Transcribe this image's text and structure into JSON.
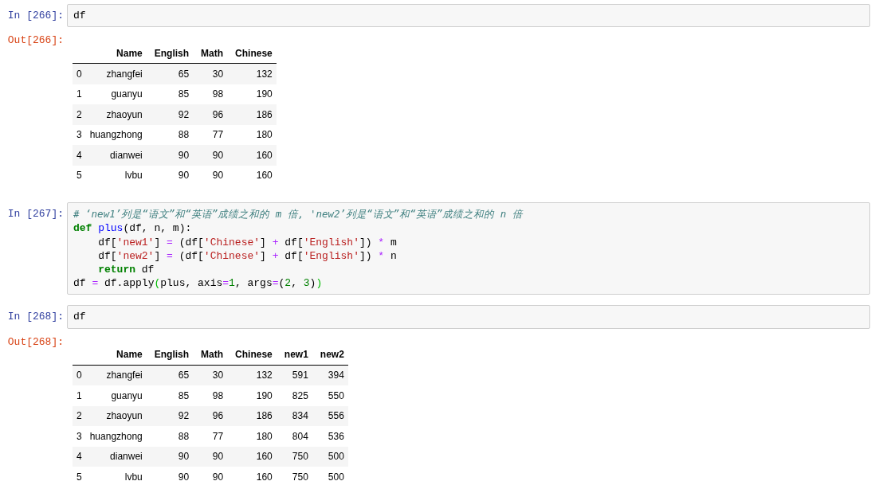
{
  "cells": [
    {
      "kind": "code",
      "prompt": "In [266]:",
      "lines": [
        [
          {
            "kind": "plain",
            "text": "df"
          }
        ]
      ]
    },
    {
      "kind": "output",
      "prompt": "Out[266]:",
      "table": {
        "columns": [
          "Name",
          "English",
          "Math",
          "Chinese"
        ],
        "rows": [
          {
            "index": "0",
            "values": [
              "zhangfei",
              "65",
              "30",
              "132"
            ]
          },
          {
            "index": "1",
            "values": [
              "guanyu",
              "85",
              "98",
              "190"
            ]
          },
          {
            "index": "2",
            "values": [
              "zhaoyun",
              "92",
              "96",
              "186"
            ]
          },
          {
            "index": "3",
            "values": [
              "huangzhong",
              "88",
              "77",
              "180"
            ]
          },
          {
            "index": "4",
            "values": [
              "dianwei",
              "90",
              "90",
              "160"
            ]
          },
          {
            "index": "5",
            "values": [
              "lvbu",
              "90",
              "90",
              "160"
            ]
          }
        ]
      }
    },
    {
      "kind": "code",
      "prompt": "In [267]:",
      "lines": [
        [
          {
            "kind": "comment",
            "text": "# ‘new1’列是“语文”和“英语”成绩之和的 m 倍, 'new2’列是“语文”和“英语”成绩之和的 n 倍"
          }
        ],
        [
          {
            "kind": "keyword",
            "text": "def"
          },
          {
            "kind": "defname",
            "text": " plus"
          },
          {
            "kind": "plain",
            "text": "(df, n, m):"
          }
        ],
        [
          {
            "kind": "plain",
            "text": "    df["
          },
          {
            "kind": "string",
            "text": "'new1'"
          },
          {
            "kind": "plain",
            "text": "] "
          },
          {
            "kind": "operator",
            "text": "="
          },
          {
            "kind": "plain",
            "text": " (df["
          },
          {
            "kind": "string",
            "text": "'Chinese'"
          },
          {
            "kind": "plain",
            "text": "] "
          },
          {
            "kind": "operator",
            "text": "+"
          },
          {
            "kind": "plain",
            "text": " df["
          },
          {
            "kind": "string",
            "text": "'English'"
          },
          {
            "kind": "plain",
            "text": "]) "
          },
          {
            "kind": "operator",
            "text": "*"
          },
          {
            "kind": "plain",
            "text": " m"
          }
        ],
        [
          {
            "kind": "plain",
            "text": "    df["
          },
          {
            "kind": "string",
            "text": "'new2'"
          },
          {
            "kind": "plain",
            "text": "] "
          },
          {
            "kind": "operator",
            "text": "="
          },
          {
            "kind": "plain",
            "text": " (df["
          },
          {
            "kind": "string",
            "text": "'Chinese'"
          },
          {
            "kind": "plain",
            "text": "] "
          },
          {
            "kind": "operator",
            "text": "+"
          },
          {
            "kind": "plain",
            "text": " df["
          },
          {
            "kind": "string",
            "text": "'English'"
          },
          {
            "kind": "plain",
            "text": "]) "
          },
          {
            "kind": "operator",
            "text": "*"
          },
          {
            "kind": "plain",
            "text": " n"
          }
        ],
        [
          {
            "kind": "keyword",
            "text": "    return"
          },
          {
            "kind": "plain",
            "text": " df"
          }
        ],
        [
          {
            "kind": "plain",
            "text": "df "
          },
          {
            "kind": "operator",
            "text": "="
          },
          {
            "kind": "plain",
            "text": " df.apply"
          },
          {
            "kind": "bracket",
            "text": "("
          },
          {
            "kind": "plain",
            "text": "plus, axis"
          },
          {
            "kind": "operator",
            "text": "="
          },
          {
            "kind": "number",
            "text": "1"
          },
          {
            "kind": "plain",
            "text": ", args"
          },
          {
            "kind": "operator",
            "text": "="
          },
          {
            "kind": "plain",
            "text": "("
          },
          {
            "kind": "number",
            "text": "2"
          },
          {
            "kind": "plain",
            "text": ", "
          },
          {
            "kind": "number",
            "text": "3"
          },
          {
            "kind": "plain",
            "text": ")"
          },
          {
            "kind": "bracket",
            "text": ")"
          }
        ]
      ]
    },
    {
      "kind": "code",
      "prompt": "In [268]:",
      "lines": [
        [
          {
            "kind": "plain",
            "text": "df"
          }
        ]
      ]
    },
    {
      "kind": "output",
      "prompt": "Out[268]:",
      "table": {
        "columns": [
          "Name",
          "English",
          "Math",
          "Chinese",
          "new1",
          "new2"
        ],
        "rows": [
          {
            "index": "0",
            "values": [
              "zhangfei",
              "65",
              "30",
              "132",
              "591",
              "394"
            ]
          },
          {
            "index": "1",
            "values": [
              "guanyu",
              "85",
              "98",
              "190",
              "825",
              "550"
            ]
          },
          {
            "index": "2",
            "values": [
              "zhaoyun",
              "92",
              "96",
              "186",
              "834",
              "556"
            ]
          },
          {
            "index": "3",
            "values": [
              "huangzhong",
              "88",
              "77",
              "180",
              "804",
              "536"
            ]
          },
          {
            "index": "4",
            "values": [
              "dianwei",
              "90",
              "90",
              "160",
              "750",
              "500"
            ]
          },
          {
            "index": "5",
            "values": [
              "lvbu",
              "90",
              "90",
              "160",
              "750",
              "500"
            ]
          }
        ]
      }
    }
  ]
}
